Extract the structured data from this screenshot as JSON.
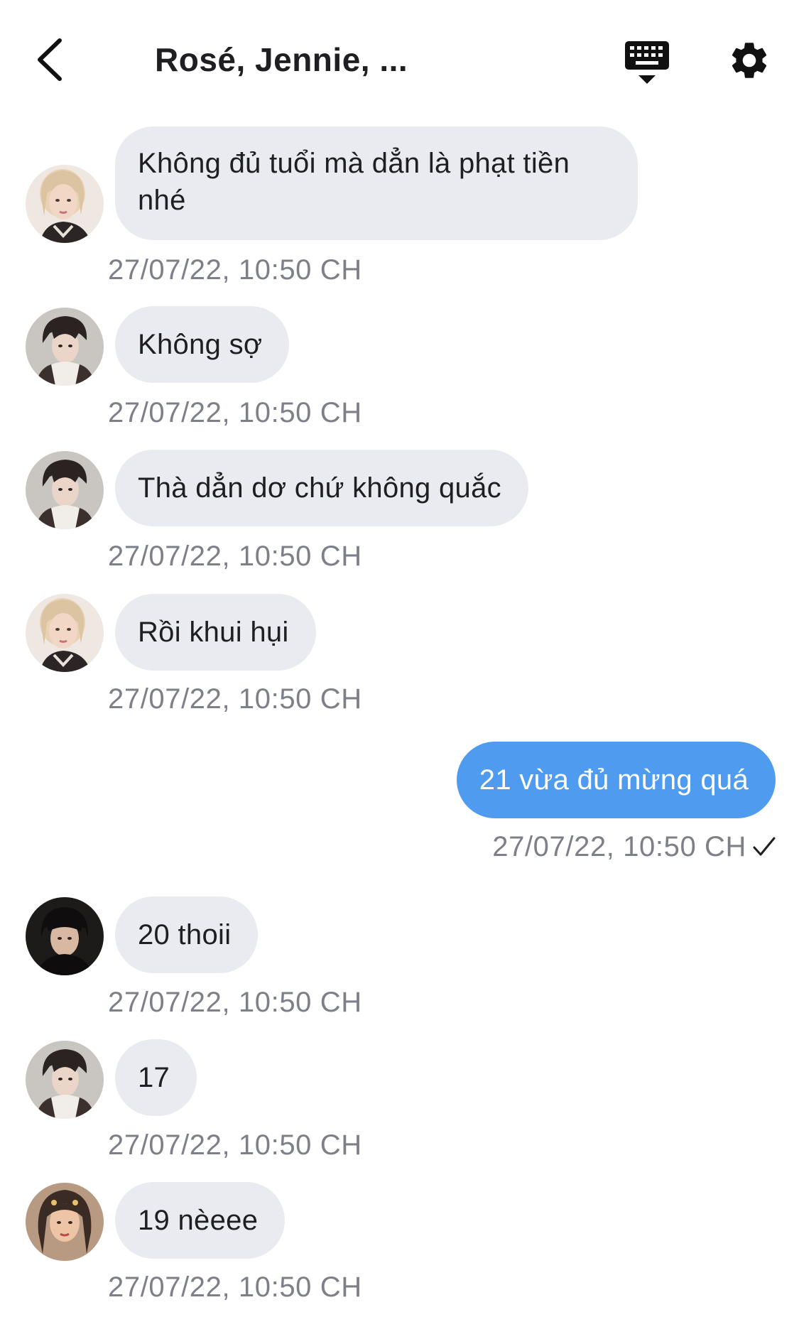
{
  "header": {
    "title": "Rosé, Jennie, ...",
    "back_icon": "chevron-left-icon",
    "keyboard_icon": "keyboard-icon",
    "settings_icon": "gear-icon"
  },
  "messages": [
    {
      "sender": "rose",
      "text": "Không đủ tuổi mà dẳn là phạt tiền nhé",
      "time": "27/07/22, 10:50 CH"
    },
    {
      "sender": "boy",
      "text": "Không sợ",
      "time": "27/07/22, 10:50 CH"
    },
    {
      "sender": "boy",
      "text": "Thà dẳn dơ chứ không quắc",
      "time": "27/07/22, 10:50 CH"
    },
    {
      "sender": "rose",
      "text": "Rồi khui hụi",
      "time": "27/07/22, 10:50 CH"
    },
    {
      "sender": "me",
      "text": "21 vừa đủ mừng quá",
      "time": "27/07/22, 10:50 CH",
      "status_icon": "check-icon"
    },
    {
      "sender": "dark",
      "text": "20 thoii",
      "time": "27/07/22, 10:50 CH"
    },
    {
      "sender": "boy",
      "text": "17",
      "time": "27/07/22, 10:50 CH"
    },
    {
      "sender": "jennie",
      "text": "19 nèeee",
      "time": "27/07/22, 10:50 CH"
    }
  ],
  "colors": {
    "incoming_bubble": "#e9ebf0",
    "outgoing_bubble": "#4e9bef",
    "timestamp": "#7d8088"
  }
}
